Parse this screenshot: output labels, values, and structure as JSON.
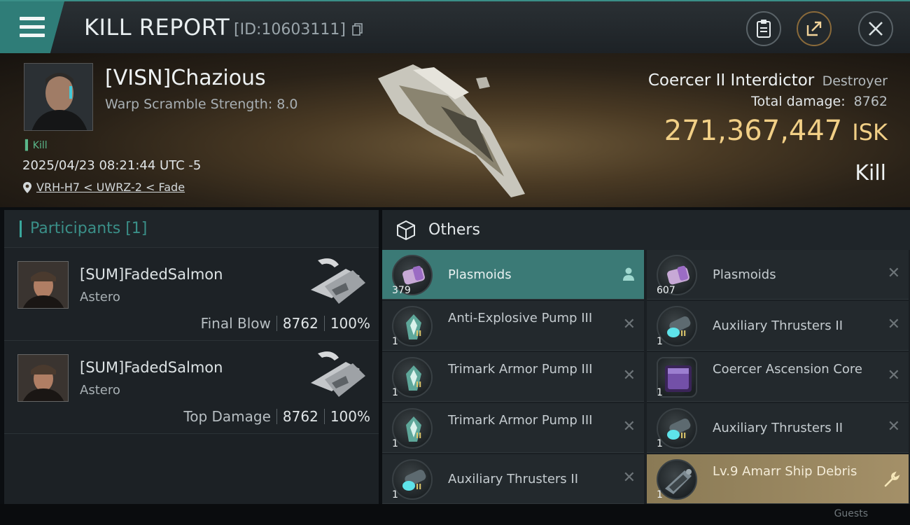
{
  "header": {
    "title": "KILL REPORT",
    "report_id": "[ID:10603111]",
    "icons": [
      "menu-icon",
      "clipboard-icon",
      "share-icon",
      "close-icon"
    ]
  },
  "victim": {
    "name": "[VISN]Chazious",
    "warp_scramble": "Warp Scramble Strength: 8.0",
    "kill_tag": "Kill",
    "datetime": "2025/04/23 08:21:44 UTC -5",
    "location": "VRH-H7 < UWRZ-2 < Fade",
    "ship_name": "Coercer II Interdictor",
    "ship_class": "Destroyer",
    "total_damage_label": "Total damage:",
    "total_damage": "8762",
    "isk_value": "271,367,447",
    "isk_unit": "ISK",
    "result": "Kill"
  },
  "participants": {
    "title": "Participants [1]",
    "items": [
      {
        "name": "[SUM]FadedSalmon",
        "ship": "Astero",
        "role": "Final Blow",
        "damage": "8762",
        "percent": "100%"
      },
      {
        "name": "[SUM]FadedSalmon",
        "ship": "Astero",
        "role": "Top Damage",
        "damage": "8762",
        "percent": "100%"
      }
    ]
  },
  "others": {
    "title": "Others",
    "items": [
      {
        "name": "Plasmoids",
        "qty": "379",
        "action": "person-icon",
        "state": "selected"
      },
      {
        "name": "Plasmoids",
        "qty": "607",
        "action": "close-icon",
        "state": "normal"
      },
      {
        "name": "Anti-Explosive Pump III",
        "qty": "1",
        "action": "close-icon",
        "state": "normal"
      },
      {
        "name": "Auxiliary Thrusters II",
        "qty": "1",
        "action": "close-icon",
        "state": "normal"
      },
      {
        "name": "Trimark Armor Pump III",
        "qty": "1",
        "action": "close-icon",
        "state": "normal"
      },
      {
        "name": "Coercer Ascension Core",
        "qty": "1",
        "action": "close-icon",
        "state": "normal"
      },
      {
        "name": "Trimark Armor Pump III",
        "qty": "1",
        "action": "close-icon",
        "state": "normal"
      },
      {
        "name": "Auxiliary Thrusters II",
        "qty": "1",
        "action": "close-icon",
        "state": "normal"
      },
      {
        "name": "Auxiliary Thrusters II",
        "qty": "1",
        "action": "close-icon",
        "state": "normal"
      },
      {
        "name": "Lv.9 Amarr Ship Debris",
        "qty": "1",
        "action": "wrench-icon",
        "state": "highlight"
      }
    ]
  },
  "footer": {
    "partial_text": "Guests"
  },
  "colors": {
    "accent": "#3a8f88",
    "isk": "#f1cf86",
    "selected": "#3b7a76",
    "highlight": "#a49068"
  }
}
